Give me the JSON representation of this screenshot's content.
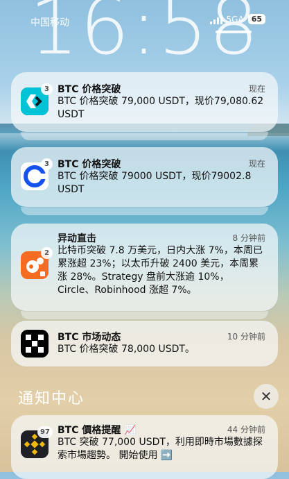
{
  "status": {
    "carrier": "中国移动",
    "clock": "16:58",
    "network": "5GA",
    "battery": "65"
  },
  "notifications": [
    {
      "app": "bitget",
      "icon": "bitget-icon",
      "badge": "3",
      "title": "BTC 价格突破",
      "time": "现在",
      "body": "BTC 价格突破 79,000 USDT，现价79,080.62 USDT"
    },
    {
      "app": "coinbase",
      "icon": "coinbase-icon",
      "badge": "3",
      "title": "BTC 价格突破",
      "time": "现在",
      "body": "BTC 价格突破 79000 USDT，现价79002.8 USDT"
    },
    {
      "app": "news",
      "icon": "squirrel-icon",
      "badge": "2",
      "title": "异动直击",
      "time": "8 分钟前",
      "body": "比特币突破 7.8 万美元，日内大涨 7%，本周已累涨超 23%；以太币升破 2400 美元，本周累涨 28%。Strategy 盘前大涨逾 10%，Circle、Robinhood 涨超 7%。"
    },
    {
      "app": "okx",
      "icon": "okx-icon",
      "badge": "",
      "title": "BTC 市场动态",
      "time": "10 分钟前",
      "body": "BTC 价格突破 78,000 USDT。"
    }
  ],
  "notification_center": {
    "title": "通知中心",
    "close": "✕"
  },
  "bottom_notification": {
    "app": "binance",
    "icon": "binance-icon",
    "badge": "97",
    "title": "BTC 價格提醒 📈",
    "time": "44 分钟前",
    "body": "BTC 突破 77,000 USDT，利用即時市場數據探索市場趨勢。 開始使用 ➡️"
  },
  "colors": {
    "binance": "#f0b90b",
    "coinbase": "#1652f0",
    "bitget": "#00c4d6",
    "squirrel": "#f46b21"
  }
}
